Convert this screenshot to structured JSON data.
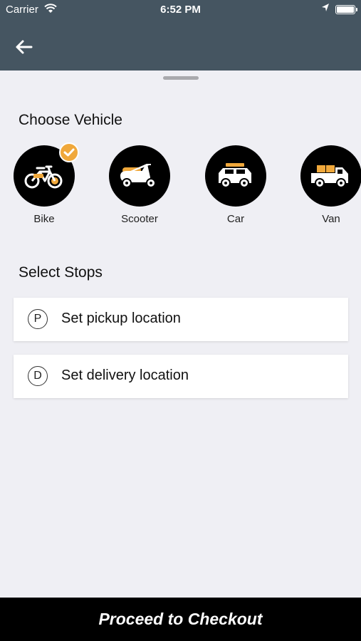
{
  "status_bar": {
    "carrier": "Carrier",
    "time": "6:52 PM"
  },
  "nav": {
    "back_icon": "arrow-left-icon"
  },
  "choose_vehicle": {
    "title": "Choose Vehicle",
    "selected": "Bike",
    "vehicles": [
      {
        "label": "Bike",
        "icon": "bike-icon"
      },
      {
        "label": "Scooter",
        "icon": "scooter-icon"
      },
      {
        "label": "Car",
        "icon": "car-icon"
      },
      {
        "label": "Van",
        "icon": "van-icon"
      }
    ]
  },
  "select_stops": {
    "title": "Select Stops",
    "stops": [
      {
        "badge": "P",
        "label": "Set pickup location"
      },
      {
        "badge": "D",
        "label": "Set delivery location"
      }
    ]
  },
  "checkout_label": "Proceed to Checkout",
  "colors": {
    "header": "#455561",
    "accent": "#f0a83b",
    "background": "#efeff4"
  }
}
